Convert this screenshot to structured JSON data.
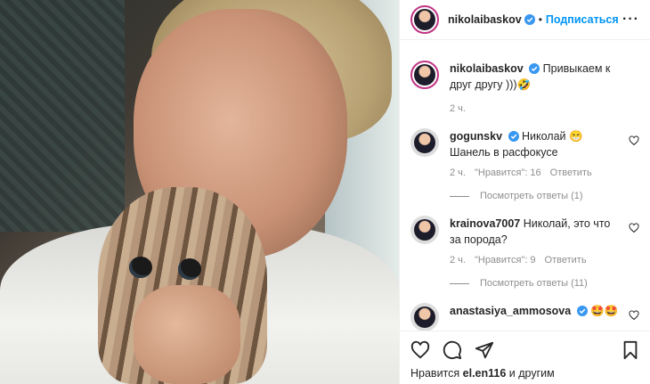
{
  "post": {
    "author": "nikolaibaskov",
    "follow_label": "Подписаться",
    "separator": "•",
    "more_label": "···",
    "caption": "Привыкаем к друг другу )))🤣",
    "caption_time": "2 ч."
  },
  "comments": [
    {
      "username": "gogunskv",
      "verified": true,
      "text": "Николай 😁 Шанель в расфокусе",
      "time": "2 ч.",
      "likes": "\"Нравится\": 16",
      "reply": "Ответить",
      "replies": "Посмотреть ответы (1)"
    },
    {
      "username": "krainova7007",
      "verified": false,
      "text": "Николай, это что за порода?",
      "time": "2 ч.",
      "likes": "\"Нравится\": 9",
      "reply": "Ответить",
      "replies": "Посмотреть ответы (11)"
    },
    {
      "username": "anastasiya_ammosova",
      "verified": true,
      "text": "🤩🤩"
    }
  ],
  "footer": {
    "liked_by_prefix": "Нравится",
    "liked_by_user": "el.en116",
    "liked_by_suffix": "и другим"
  },
  "icons": {
    "verified": "verified-badge-icon",
    "heart": "heart-icon",
    "comment": "comment-icon",
    "share": "share-icon",
    "bookmark": "bookmark-icon"
  },
  "colors": {
    "accent": "#0095f6",
    "muted": "#8e8e8e",
    "text": "#262626"
  }
}
